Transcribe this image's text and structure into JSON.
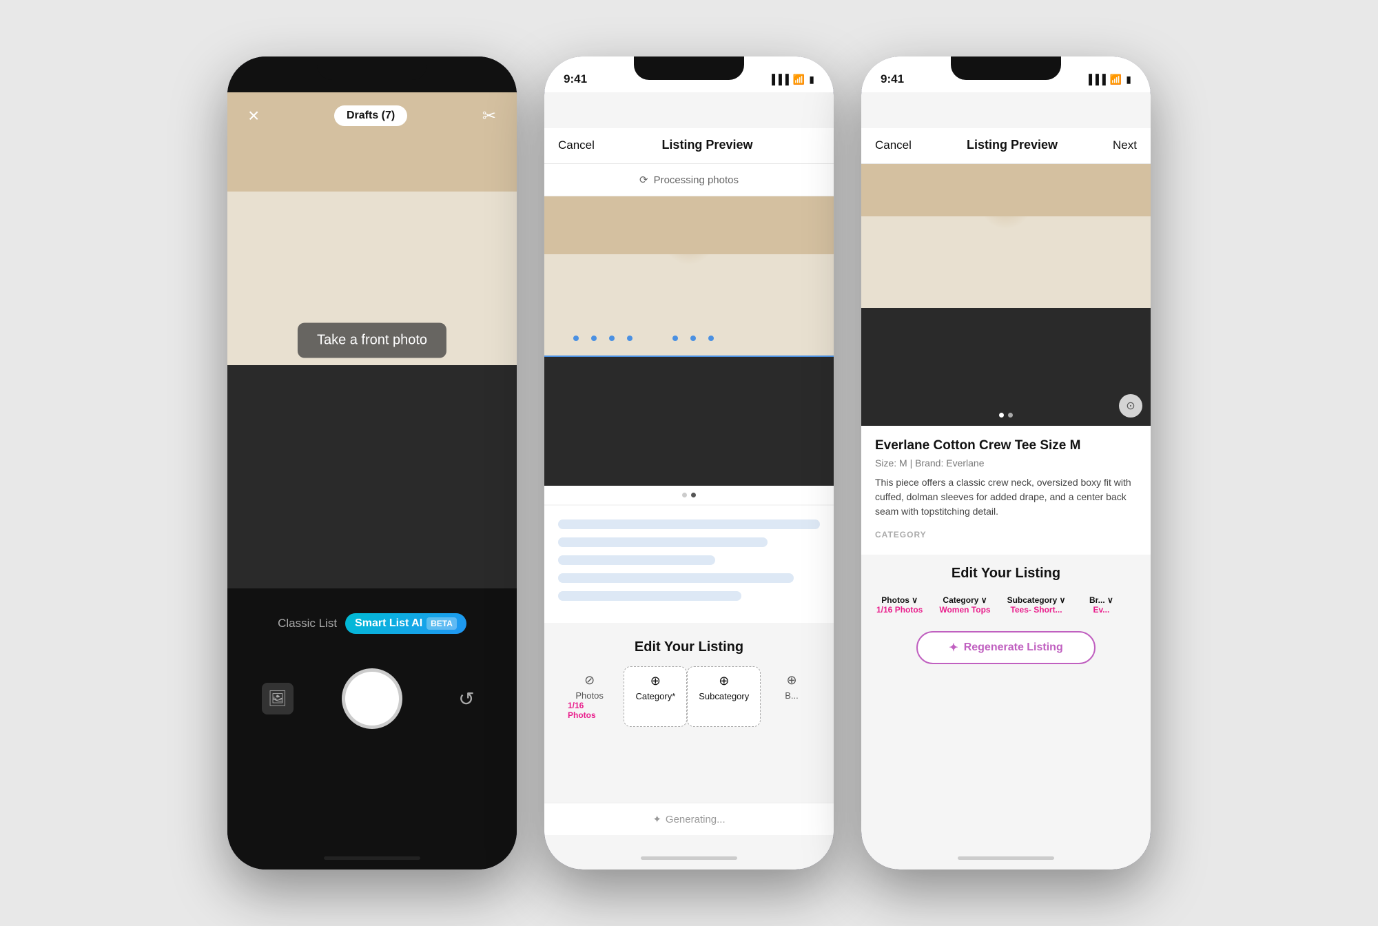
{
  "phone1": {
    "topBar": {
      "closeLabel": "×",
      "draftsLabel": "Drafts (7)",
      "scissorsLabel": "✂"
    },
    "camera": {
      "overlayText": "Take a front photo"
    },
    "toggleRow": {
      "classicLabel": "Classic List",
      "smartLabel": "Smart List AI",
      "betaLabel": "BETA"
    },
    "controls": {
      "galleryIcon": "🖼",
      "flipIcon": "↺"
    }
  },
  "phone2": {
    "statusTime": "9:41",
    "header": {
      "cancelLabel": "Cancel",
      "title": "Listing Preview",
      "nextLabel": ""
    },
    "processingBanner": {
      "icon": "⟳",
      "text": "Processing photos"
    },
    "imageDots": [
      {
        "active": false
      },
      {
        "active": true
      }
    ],
    "editSection": {
      "title": "Edit Your Listing"
    },
    "tabs": [
      {
        "label": "Photos",
        "value": "1/16 Photos",
        "icon": "",
        "active": false
      },
      {
        "label": "Category*",
        "value": "",
        "icon": "⊕",
        "active": true
      },
      {
        "label": "Subcategory",
        "value": "",
        "icon": "⊕",
        "active": true
      },
      {
        "label": "B...",
        "value": "",
        "icon": "",
        "active": false
      }
    ],
    "generating": {
      "icon": "✦",
      "text": "Generating..."
    }
  },
  "phone3": {
    "statusTime": "9:41",
    "header": {
      "cancelLabel": "Cancel",
      "title": "Listing Preview",
      "nextLabel": "Next"
    },
    "listing": {
      "title": "Everlane Cotton Crew Tee Size M",
      "meta": "Size: M  |  Brand: Everlane",
      "description": "This piece offers a classic crew neck, oversized boxy fit with cuffed, dolman sleeves for added drape, and a center back seam with topstitching detail.",
      "categoryLabel": "CATEGORY"
    },
    "imageDots": [
      {
        "active": true
      },
      {
        "active": false
      }
    ],
    "editSection": {
      "title": "Edit Your Listing"
    },
    "tabs": [
      {
        "label": "Photos",
        "value": "1/16 Photos",
        "chevron": "∨"
      },
      {
        "label": "Category",
        "sublabel": "Women Tops",
        "chevron": "∨"
      },
      {
        "label": "Subcategory",
        "sublabel": "Tees- Short...",
        "chevron": "∨"
      },
      {
        "label": "Br...",
        "sublabel": "Ev...",
        "chevron": "∨"
      }
    ],
    "regenerateBtn": {
      "icon": "✦",
      "label": "Regenerate Listing"
    }
  }
}
